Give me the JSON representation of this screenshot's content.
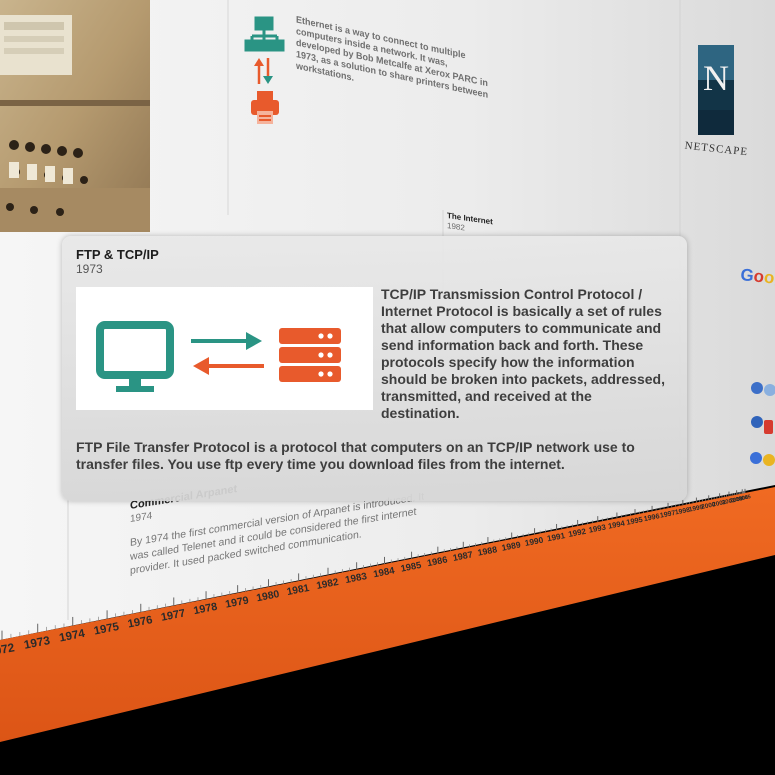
{
  "window": {
    "title": "FTP & TCP/IP"
  },
  "ethernet": {
    "text": "Ethernet is a way to connect to multiple computers inside a network. It was, developed by Bob Metcalfe at Xerox PARC in 1973, as a solution to share printers between workstations.",
    "icon": "network-icon",
    "printer_icon": "printer-icon"
  },
  "internet": {
    "title": "The Internet",
    "year": "1982"
  },
  "netscape": {
    "logo_letter": "N",
    "logo_word": "NETSCAPE"
  },
  "google": {
    "logo": "Google"
  },
  "commercial_arpanet": {
    "title": "Commercial Arpanet",
    "year": "1974",
    "text": "By 1974 the first commercial version of Arpanet is introduced. It was called Telenet and it could be considered the first internet provider. It used packed switched communication."
  },
  "ftp_card": {
    "title": "FTP & TCP/IP",
    "year": "1973",
    "paragraph1": "TCP/IP Transmission Control Protocol / Internet Protocol is basically a set of rules that allow computers to communicate and send information back and forth. These protocols specify how the information should be broken into packets, addressed, transmitted, and received at the destination.",
    "paragraph2": "FTP File Transfer Protocol is a protocol that computers on an TCP/IP network use to transfer files. You use ftp every time you download files from the internet.",
    "image_icons": [
      "monitor-icon",
      "transfer-arrows-icon",
      "server-icon"
    ]
  },
  "colors": {
    "timeline_orange": "#e8611d",
    "icon_teal": "#2a9484",
    "icon_orange": "#e85a2c",
    "card_bg": "#dcdcdc"
  },
  "timeline": {
    "years": [
      "1972",
      "1973",
      "1974",
      "1975",
      "1976",
      "1977",
      "1978",
      "1979",
      "1980",
      "1981",
      "1982",
      "1983",
      "1984",
      "1985",
      "1986",
      "1987",
      "1988",
      "1989",
      "1990",
      "1991",
      "1992",
      "1993",
      "1994",
      "1995",
      "1996",
      "1997",
      "1998",
      "1999",
      "2000",
      "2001",
      "2002",
      "2003",
      "2004",
      "2005"
    ]
  }
}
